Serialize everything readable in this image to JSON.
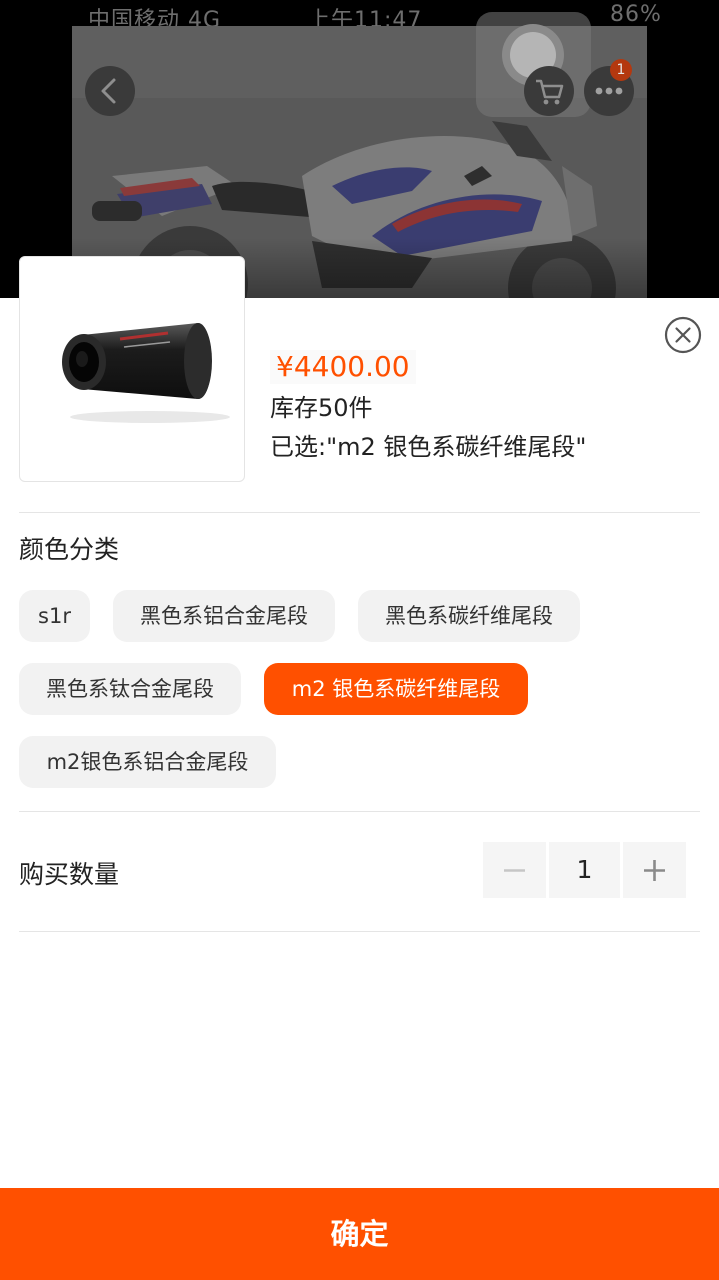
{
  "status_bar": {
    "carrier": "中国移动 4G",
    "time": "上午11:47",
    "battery": "86%"
  },
  "background": {
    "cart_badge_count": "1"
  },
  "sku_panel": {
    "price": "¥4400.00",
    "stock": "库存50件",
    "selected_text": "已选:\"m2 银色系碳纤维尾段\"",
    "color_section_title": "颜色分类",
    "color_options": [
      {
        "label": "s1r",
        "selected": false
      },
      {
        "label": "黑色系铝合金尾段",
        "selected": false
      },
      {
        "label": "黑色系碳纤维尾段",
        "selected": false
      },
      {
        "label": "黑色系钛合金尾段",
        "selected": false
      },
      {
        "label": "m2 银色系碳纤维尾段",
        "selected": true
      },
      {
        "label": "m2银色系铝合金尾段",
        "selected": false
      }
    ],
    "quantity_label": "购买数量",
    "quantity_value": "1",
    "confirm_label": "确定"
  },
  "colors": {
    "accent": "#ff5000",
    "chip_bg": "#f2f2f2",
    "overlay": "#000000"
  },
  "icons": {
    "back": "chevron-left-icon",
    "cart": "cart-icon",
    "more": "ellipsis-icon",
    "close": "close-circle-icon",
    "minus": "minus-icon",
    "plus": "plus-icon"
  }
}
